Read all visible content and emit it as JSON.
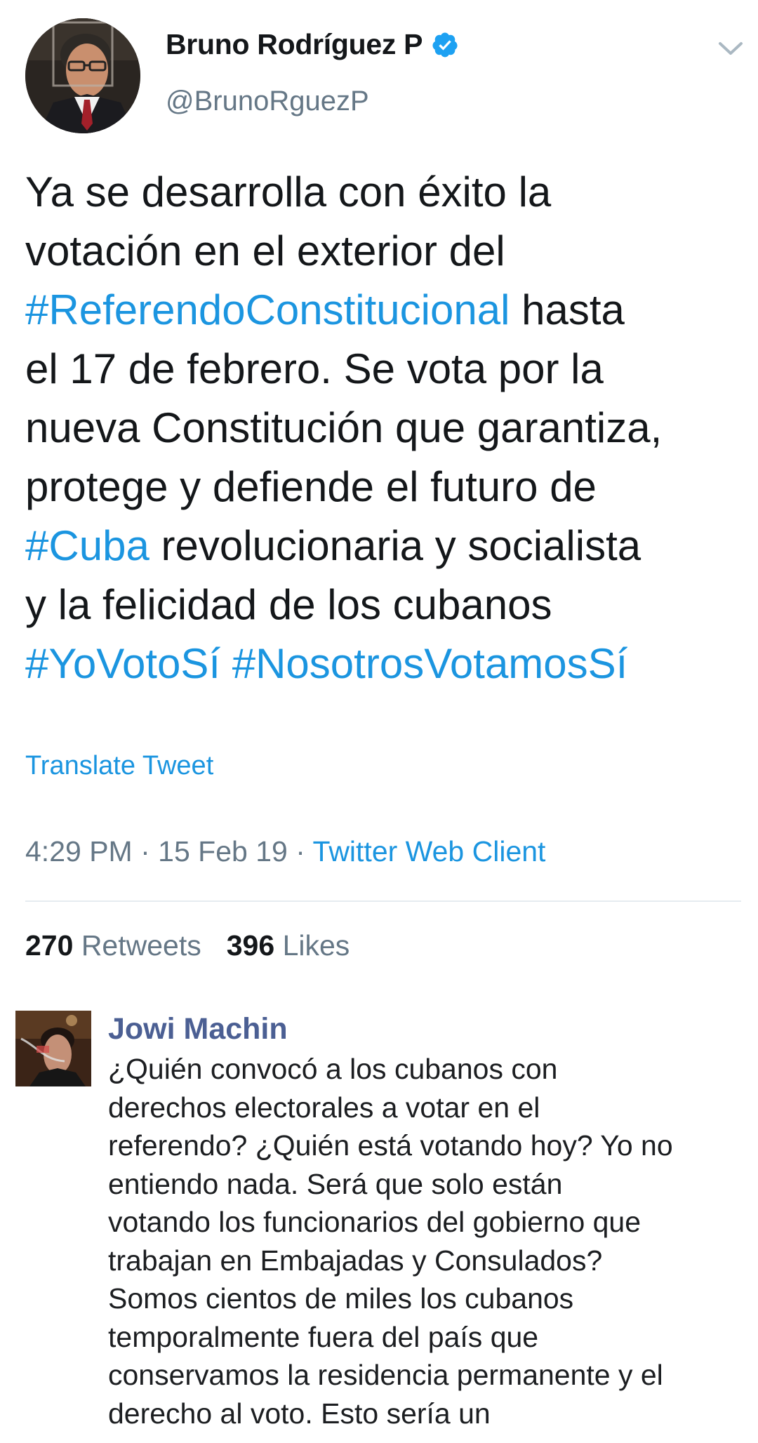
{
  "tweet": {
    "author": {
      "name": "Bruno Rodríguez P",
      "handle": "@BrunoRguezP"
    },
    "text_lines": [
      [
        {
          "t": "Ya se desarrolla con éxito la",
          "h": false
        }
      ],
      [
        {
          "t": "votación en el exterior del",
          "h": false
        }
      ],
      [
        {
          "t": "#ReferendoConstitucional",
          "h": true
        },
        {
          "t": " hasta",
          "h": false
        }
      ],
      [
        {
          "t": "el 17 de febrero. Se vota por la",
          "h": false
        }
      ],
      [
        {
          "t": "nueva Constitución que garantiza,",
          "h": false
        }
      ],
      [
        {
          "t": "protege y defiende el futuro de",
          "h": false
        }
      ],
      [
        {
          "t": "#Cuba",
          "h": true
        },
        {
          "t": " revolucionaria y socialista",
          "h": false
        }
      ],
      [
        {
          "t": "y la felicidad de los cubanos",
          "h": false
        }
      ],
      [
        {
          "t": "#YoVotoSí",
          "h": true
        },
        {
          "t": " ",
          "h": false
        },
        {
          "t": "#NosotrosVotamosSí",
          "h": true
        }
      ]
    ],
    "translate_label": "Translate Tweet",
    "time": "4:29 PM",
    "separator": "·",
    "date": "15 Feb 19",
    "client": "Twitter Web Client",
    "retweets_count": "270",
    "retweets_label": "Retweets",
    "likes_count": "396",
    "likes_label": "Likes",
    "link_color": "#1b95e0",
    "icons": [
      "verified-badge-icon",
      "chevron-down-icon"
    ]
  },
  "comment": {
    "author": "Jowi Machin",
    "lines": [
      "¿Quién convocó a los cubanos con",
      "derechos electorales a votar en el",
      "referendo? ¿Quién está votando hoy? Yo no",
      "entiendo nada. Será que solo están",
      "votando los funcionarios del gobierno que",
      "trabajan en Embajadas y Consulados?",
      "Somos cientos de miles los cubanos",
      "temporalmente fuera del país que",
      "conservamos la residencia permanente y el",
      "derecho al voto. Esto sería un"
    ],
    "name_color": "#4b5f93"
  }
}
